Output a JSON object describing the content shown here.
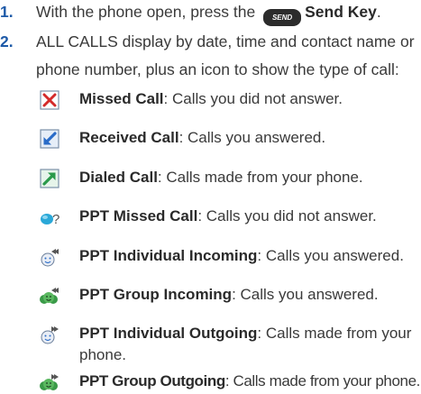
{
  "steps": [
    {
      "number": "1.",
      "text_before": "With the phone open, press the",
      "key_icon_text": "SEND",
      "key_label": "Send Key",
      "text_after": "."
    },
    {
      "number": "2.",
      "line1": "ALL CALLS display by date, time and contact name or",
      "line2": "phone number, plus an icon to show the type of call:"
    }
  ],
  "call_types": [
    {
      "icon": "missed-call-icon",
      "label": "Missed Call",
      "desc": ": Calls you did not answer."
    },
    {
      "icon": "received-call-icon",
      "label": "Received Call",
      "desc": ": Calls you answered."
    },
    {
      "icon": "dialed-call-icon",
      "label": "Dialed Call",
      "desc": ": Calls made from your phone."
    },
    {
      "icon": "ppt-missed-call-icon",
      "label": "PPT Missed Call",
      "desc": ": Calls you did not answer."
    },
    {
      "icon": "ppt-individual-incoming-icon",
      "label": "PPT Individual Incoming",
      "desc": ": Calls you answered."
    },
    {
      "icon": "ppt-group-incoming-icon",
      "label": "PPT Group Incoming",
      "desc": ": Calls you answered."
    },
    {
      "icon": "ppt-individual-outgoing-icon",
      "label": "PPT Individual Outgoing",
      "desc": ": Calls made from your",
      "desc_line2": "phone."
    },
    {
      "icon": "ppt-group-outgoing-icon",
      "label": "PPT Group Outgoing",
      "desc": ": Calls made from your phone."
    }
  ],
  "colors": {
    "step_number": "#1e5aa8",
    "missed_red": "#d42a2a",
    "received_blue": "#2a6cc8",
    "dialed_green": "#2a9a4a"
  }
}
